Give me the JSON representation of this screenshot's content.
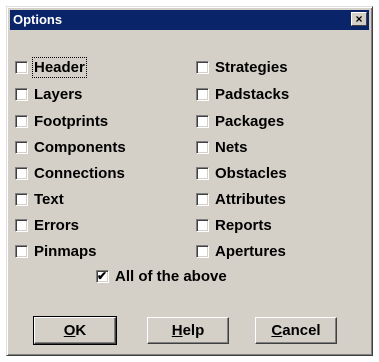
{
  "window": {
    "title": "Options",
    "close_glyph": "×"
  },
  "left_options": [
    {
      "label": "Header",
      "checked": false
    },
    {
      "label": "Layers",
      "checked": false
    },
    {
      "label": "Footprints",
      "checked": false
    },
    {
      "label": "Components",
      "checked": false
    },
    {
      "label": "Connections",
      "checked": false
    },
    {
      "label": "Text",
      "checked": false
    },
    {
      "label": "Errors",
      "checked": false
    },
    {
      "label": "Pinmaps",
      "checked": false
    }
  ],
  "right_options": [
    {
      "label": "Strategies",
      "checked": false
    },
    {
      "label": "Padstacks",
      "checked": false
    },
    {
      "label": "Packages",
      "checked": false
    },
    {
      "label": "Nets",
      "checked": false
    },
    {
      "label": "Obstacles",
      "checked": false
    },
    {
      "label": "Attributes",
      "checked": false
    },
    {
      "label": "Reports",
      "checked": false
    },
    {
      "label": "Apertures",
      "checked": false
    }
  ],
  "all_of_above": {
    "label": "All of the above",
    "checked": true
  },
  "buttons": {
    "ok": {
      "mnemonic": "O",
      "rest": "K"
    },
    "help": {
      "mnemonic": "H",
      "rest": "elp"
    },
    "cancel": {
      "mnemonic": "C",
      "rest": "ancel"
    }
  }
}
